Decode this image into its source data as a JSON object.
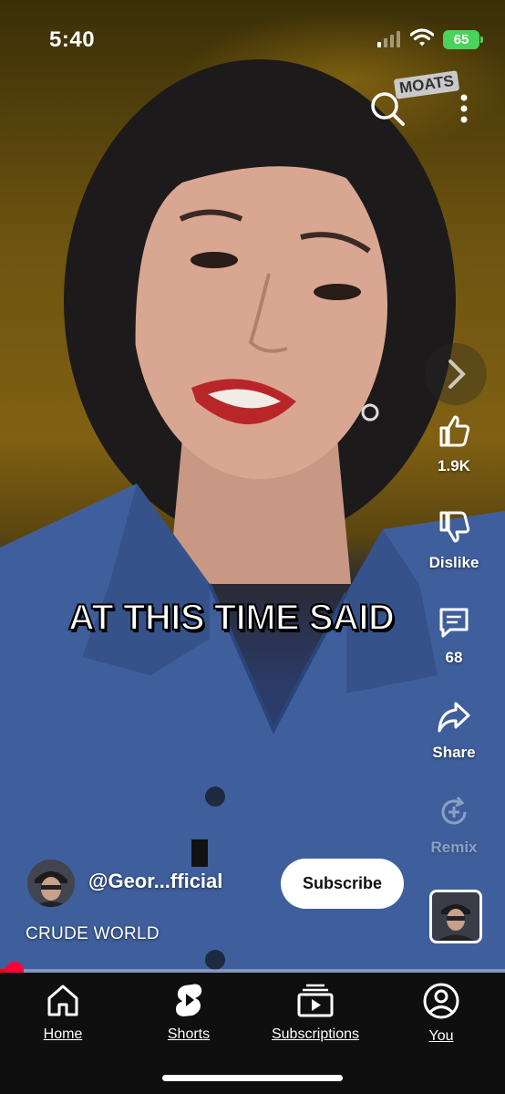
{
  "status_bar": {
    "time": "5:40",
    "battery": "65"
  },
  "watermark": {
    "text": "MOATS"
  },
  "video": {
    "caption": "AT THIS TIME SAID"
  },
  "actions": {
    "like_count": "1.9K",
    "dislike_label": "Dislike",
    "comments_count": "68",
    "share_label": "Share",
    "remix_label": "Remix"
  },
  "channel": {
    "handle": "@Geor...fficial",
    "subscribe_label": "Subscribe"
  },
  "short_title": "CRUDE WORLD",
  "progress": {
    "fraction": 0.03
  },
  "nav": {
    "home": "Home",
    "shorts": "Shorts",
    "subscriptions": "Subscriptions",
    "you": "You"
  },
  "colors": {
    "accent_red": "#ff0000",
    "battery_green": "#4ad35a",
    "nav_bg": "#0f0f0f"
  }
}
